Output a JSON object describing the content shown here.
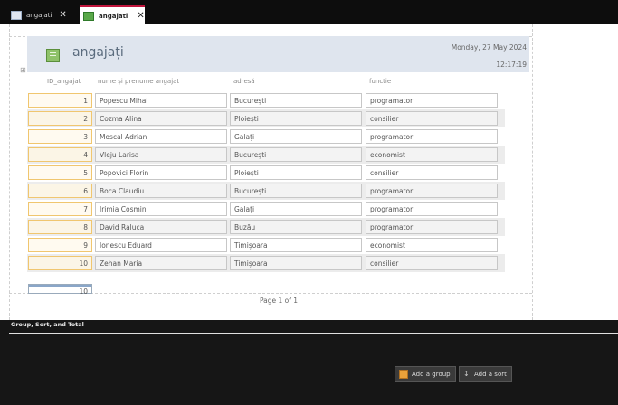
{
  "tabs": [
    {
      "label": "angajati",
      "close": "✕"
    },
    {
      "label": "angajati",
      "close": "✕"
    }
  ],
  "report": {
    "title": "angajați",
    "date": "Monday, 27 May 2024",
    "time": "12:17:19",
    "anchor_glyph": "⊞"
  },
  "columns": {
    "id": "ID_angajat",
    "nume": "nume și prenume angajat",
    "adresa": "adresă",
    "functie": "functie"
  },
  "rows": [
    {
      "id": "1",
      "nume": "Popescu Mihai",
      "adresa": "București",
      "functie": "programator"
    },
    {
      "id": "2",
      "nume": "Cozma Alina",
      "adresa": "Ploiești",
      "functie": "consilier"
    },
    {
      "id": "3",
      "nume": "Moscal Adrian",
      "adresa": "Galați",
      "functie": "programator"
    },
    {
      "id": "4",
      "nume": "Vleju Larisa",
      "adresa": "București",
      "functie": "economist"
    },
    {
      "id": "5",
      "nume": "Popovici Florin",
      "adresa": "Ploiești",
      "functie": "consilier"
    },
    {
      "id": "6",
      "nume": "Boca Claudiu",
      "adresa": "București",
      "functie": "programator"
    },
    {
      "id": "7",
      "nume": "Irimia Cosmin",
      "adresa": "Galați",
      "functie": "programator"
    },
    {
      "id": "8",
      "nume": "David Raluca",
      "adresa": "Buzău",
      "functie": "programator"
    },
    {
      "id": "9",
      "nume": "Ionescu Eduard",
      "adresa": "Timișoara",
      "functie": "economist"
    },
    {
      "id": "10",
      "nume": "Zehan Maria",
      "adresa": "Timișoara",
      "functie": "consilier"
    }
  ],
  "total": "10",
  "page_label": "Page 1 of 1",
  "panel": {
    "title": "Group, Sort, and Total",
    "add_group": "Add a group",
    "add_sort": "Add a sort",
    "sort_glyph": "↕"
  }
}
